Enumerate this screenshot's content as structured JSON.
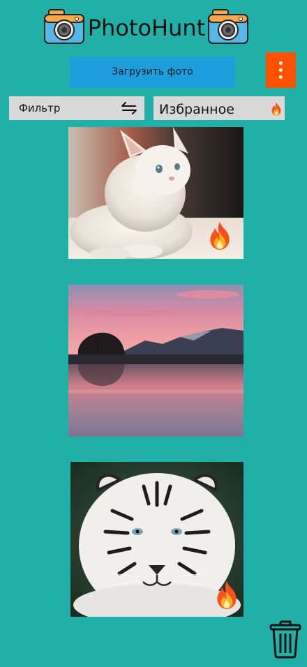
{
  "header": {
    "title": "PhotoHunt",
    "logo_icon": "camera-icon"
  },
  "toolbar": {
    "upload_label": "Загрузить фото",
    "menu_icon": "more-vertical-icon",
    "filter_label": "Фильтр",
    "filter_icon": "swap-arrows-icon",
    "favorites_label": "Избранное",
    "favorites_icon": "fire-icon"
  },
  "photos": [
    {
      "subject": "white kitten",
      "favorite": true
    },
    {
      "subject": "sunset lake",
      "favorite": false
    },
    {
      "subject": "white tiger",
      "favorite": true
    }
  ],
  "footer": {
    "trash_icon": "trash-icon"
  },
  "colors": {
    "background": "#20b0a7",
    "upload_button": "#1f9ede",
    "menu_button": "#ff5100",
    "control_bg": "#d9d9d9"
  }
}
